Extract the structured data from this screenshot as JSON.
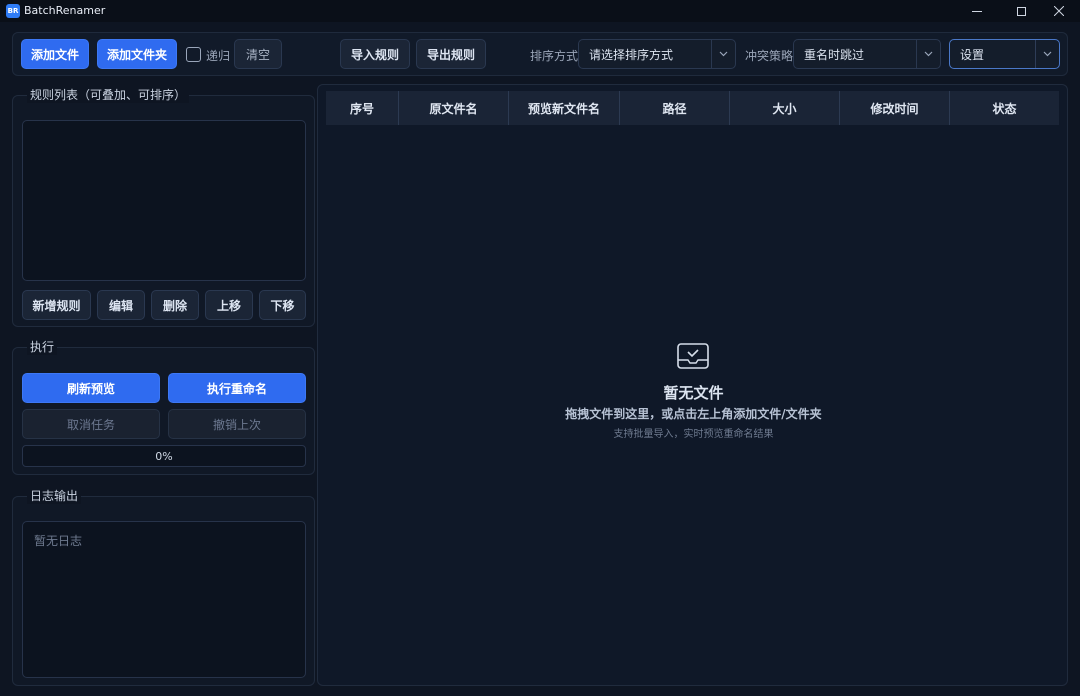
{
  "window": {
    "title": "BatchRenamer",
    "icon_text": "BR"
  },
  "toolbar": {
    "add_file": "添加文件",
    "add_folder": "添加文件夹",
    "recursive_label": "递归",
    "clear": "清空",
    "import_rules": "导入规则",
    "export_rules": "导出规则",
    "sort_label": "排序方式",
    "sort_value": "请选择排序方式",
    "conflict_label": "冲突策略",
    "conflict_value": "重名时跳过",
    "settings_value": "设置"
  },
  "rules_panel": {
    "title": "规则列表（可叠加、可排序）",
    "add_rule": "新增规则",
    "edit": "编辑",
    "delete": "删除",
    "move_up": "上移",
    "move_down": "下移"
  },
  "exec_panel": {
    "title": "执行",
    "refresh_preview": "刷新预览",
    "execute_rename": "执行重命名",
    "cancel_task": "取消任务",
    "undo_last": "撤销上次",
    "progress_text": "0%",
    "progress": 0
  },
  "log_panel": {
    "title": "日志输出",
    "placeholder": "暂无日志"
  },
  "table": {
    "columns": [
      "序号",
      "原文件名",
      "预览新文件名",
      "路径",
      "大小",
      "修改时间",
      "状态"
    ],
    "empty_title": "暂无文件",
    "empty_subtitle": "拖拽文件到这里，或点击左上角添加文件/文件夹",
    "empty_hint": "支持批量导入，实时预览重命名结果"
  },
  "colors": {
    "primary": "#2f6bf0",
    "background": "#0e1522",
    "panel": "#101826"
  }
}
